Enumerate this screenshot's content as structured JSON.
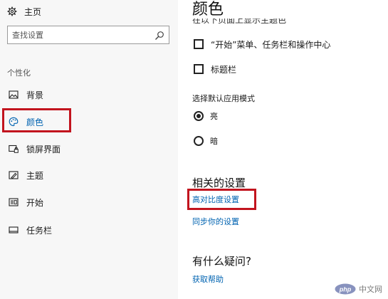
{
  "sidebar": {
    "home_label": "主页",
    "search_placeholder": "查找设置",
    "section_heading": "个性化",
    "items": [
      {
        "label": "背景",
        "icon": "image-icon"
      },
      {
        "label": "颜色",
        "icon": "palette-icon",
        "active": true
      },
      {
        "label": "锁屏界面",
        "icon": "lock-screen-icon"
      },
      {
        "label": "主题",
        "icon": "theme-icon"
      },
      {
        "label": "开始",
        "icon": "start-icon"
      },
      {
        "label": "任务栏",
        "icon": "taskbar-icon"
      }
    ]
  },
  "main": {
    "title": "颜色",
    "cut_off_label": "在以下页面上显示主题色",
    "checkboxes": [
      {
        "label": "“开始”菜单、任务栏和操作中心",
        "checked": false
      },
      {
        "label": "标题栏",
        "checked": false
      }
    ],
    "app_mode_label": "选择默认应用模式",
    "modes": [
      {
        "label": "亮",
        "checked": true
      },
      {
        "label": "暗",
        "checked": false
      }
    ],
    "related_heading": "相关的设置",
    "related_links": [
      "高对比度设置",
      "同步你的设置"
    ],
    "question_heading": "有什么疑问?",
    "help_link": "获取帮助"
  },
  "watermark": {
    "logo_text": "php",
    "text": "中文网"
  },
  "colors": {
    "accent": "#0063b1",
    "highlight": "#c2141e"
  }
}
